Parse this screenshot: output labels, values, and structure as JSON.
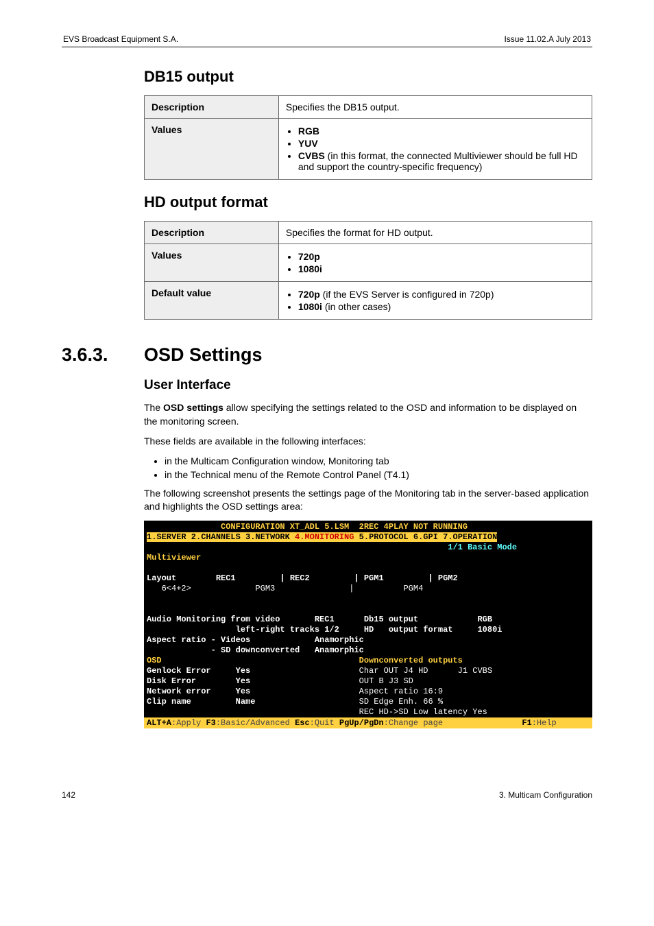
{
  "header": {
    "left": "EVS Broadcast Equipment S.A.",
    "right": "Issue 11.02.A  July 2013"
  },
  "sec1": {
    "title": "DB15 output",
    "rows": {
      "description_label": "Description",
      "description_text": "Specifies the DB15 output.",
      "values_label": "Values",
      "v1": "RGB",
      "v2": "YUV",
      "v3_bold": "CVBS",
      "v3_rest": " (in this format, the connected Multiviewer should be full HD and support the country-specific frequency)"
    }
  },
  "sec2": {
    "title": "HD output format",
    "rows": {
      "description_label": "Description",
      "description_text": "Specifies the format for HD output.",
      "values_label": "Values",
      "v1": "720p",
      "v2": "1080i",
      "default_label": "Default value",
      "d1_bold": "720p",
      "d1_rest": " (if the EVS Server is configured in 720p)",
      "d2_bold": "1080i",
      "d2_rest": " (in other cases)"
    }
  },
  "sec3": {
    "num": "3.6.3.",
    "title": "OSD Settings",
    "ui_title": "User Interface",
    "p1a": "The ",
    "p1b": "OSD settings",
    "p1c": " allow specifying the settings related to the OSD and information to be displayed on the monitoring screen.",
    "p2": "These fields are available in the following interfaces:",
    "li1": "in the Multicam Configuration window, Monitoring tab",
    "li2": "in the Technical menu of the Remote Control Panel (T4.1)",
    "p3": "The following screenshot presents the settings page of the Monitoring tab in the server-based application and highlights the OSD settings area:"
  },
  "term": {
    "line1a": "               CONFIGURATION XT_ADL 5.LSM  2REC 4PLAY NOT RUNNING",
    "tabs_pre": "1.SERVER 2.CHANNELS 3.NETWORK ",
    "tab_active": "4.MONITORING",
    "tabs_post": " 5.PROTOCOL 6.GPI 7.OPERATION",
    "mode": "                                                             1/1 Basic Mode",
    "mv": "Multiviewer",
    "layout": "Layout        REC1         | REC2         | PGM1         | PGM2",
    "layout2": "   6<4+2>             PGM3               |          PGM4",
    "blk1": "Audio Monitoring from video       REC1      Db15 output            RGB",
    "blk2": "                  left-right tracks 1/2     HD   output format     1080i",
    "blk3": "Aspect ratio - Videos             Anamorphic",
    "blk4": "             - SD downconverted   Anamorphic",
    "osd_hdr1": "OSD                                        ",
    "osd_hdr2": "Downconverted outputs",
    "osd1a": "Genlock Error     Yes                      ",
    "osd1b": "Char OUT J4 HD      J1 CVBS",
    "osd2a": "Disk Error        Yes                      ",
    "osd2b": "OUT B J3 SD",
    "osd3a": "Network error     Yes                      ",
    "osd3b": "Aspect ratio 16:9",
    "osd4a": "Clip name         Name                     ",
    "osd4b": "SD Edge Enh. 66 %",
    "osd5a": "                                           ",
    "osd5b": "REC HD->SD Low latency Yes",
    "footer": {
      "k1": "ALT+A",
      "t1": ":Apply ",
      "k2": "F3",
      "t2": ":Basic/Advanced ",
      "k3": "Esc",
      "t3": ":Quit ",
      "k4": "PgUp/PgDn",
      "t4": ":Change page                ",
      "k5": "F1",
      "t5": ":Help"
    }
  },
  "footer": {
    "left": "142",
    "right": "3. Multicam Configuration"
  }
}
